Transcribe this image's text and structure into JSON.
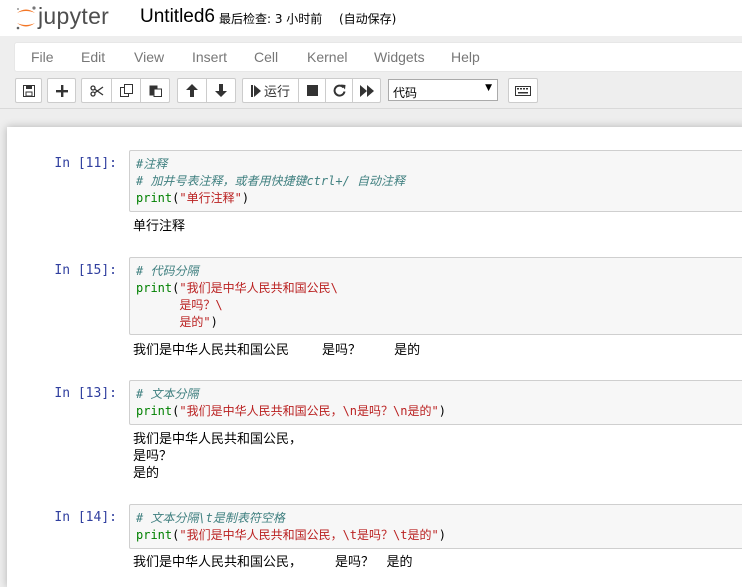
{
  "header": {
    "logo_text": "jupyter",
    "notebook_title": "Untitled6",
    "checkpoint": "最后检查: 3 小时前",
    "autosave": "(自动保存)"
  },
  "menu": [
    "File",
    "Edit",
    "View",
    "Insert",
    "Cell",
    "Kernel",
    "Widgets",
    "Help"
  ],
  "toolbar": {
    "run_label": "运行",
    "cell_type": "代码"
  },
  "cells": [
    {
      "prompt": "In [11]:",
      "code": [
        "#注释",
        "# 加井号表注释，或者用快捷键ctrl+/ 自动注释",
        "print(\"单行注释\")"
      ],
      "output": [
        "单行注释"
      ]
    },
    {
      "prompt": "In [15]:",
      "code": [
        "# 代码分隔",
        "print(\"我们是中华人民共和国公民\\",
        "      是吗？\\",
        "      是的\")"
      ],
      "output": [
        "我们是中华人民共和国公民        是吗？        是的"
      ]
    },
    {
      "prompt": "In [13]:",
      "code": [
        "# 文本分隔",
        "print(\"我们是中华人民共和国公民，\\n是吗？\\n是的\")"
      ],
      "output": [
        "我们是中华人民共和国公民，",
        "是吗？",
        "是的"
      ]
    },
    {
      "prompt": "In [14]:",
      "code": [
        "# 文本分隔\\t是制表符空格",
        "print(\"我们是中华人民共和国公民，\\t是吗？\\t是的\")"
      ],
      "output": [
        "我们是中华人民共和国公民，        是吗？   是的"
      ]
    }
  ]
}
